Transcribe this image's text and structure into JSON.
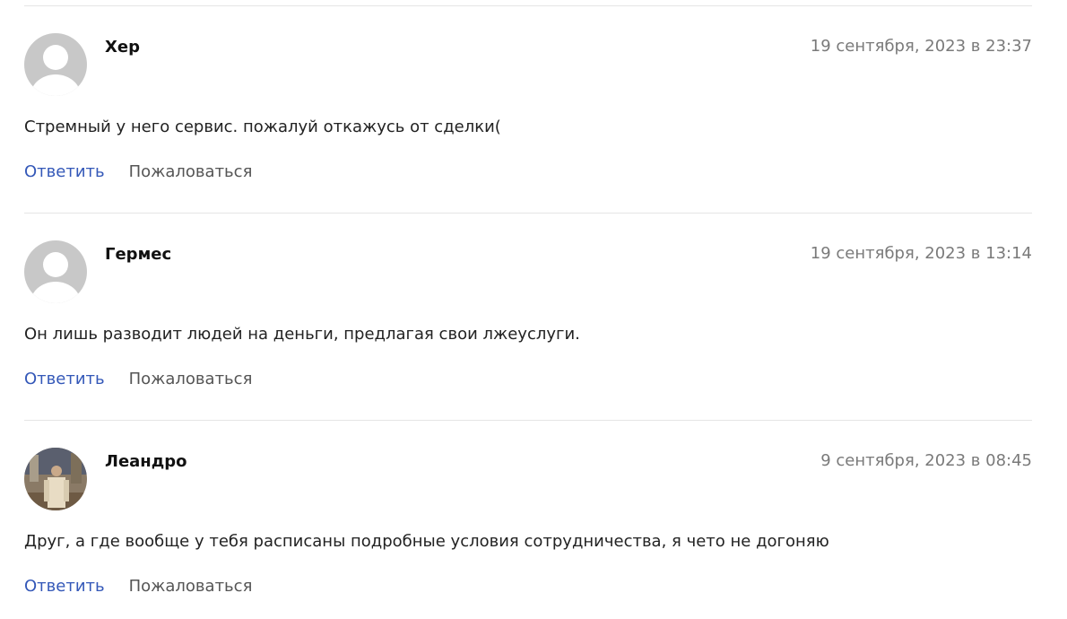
{
  "comments": [
    {
      "author": "Хер",
      "date": "19 сентября, 2023 в 23:37",
      "text": "Стремный у него сервис. пожалуй откажусь от сделки(",
      "avatar": "default-avatar-icon",
      "reply_label": "Ответить",
      "report_label": "Пожаловаться"
    },
    {
      "author": "Гермес",
      "date": "19 сентября, 2023 в 13:14",
      "text": "Он лишь разводит людей на деньги, предлагая свои лжеуслуги.",
      "avatar": "default-avatar-icon",
      "reply_label": "Ответить",
      "report_label": "Пожаловаться"
    },
    {
      "author": "Леандро",
      "date": "9 сентября, 2023 в 08:45",
      "text": "Друг, а где вообще у тебя расписаны подробные условия сотрудничества, я чето не догоняю",
      "avatar": "user-photo",
      "reply_label": "Ответить",
      "report_label": "Пожаловаться"
    }
  ],
  "colors": {
    "reply_link": "#3458b8",
    "report_link": "#555555",
    "date": "#7a7a7a",
    "divider": "#e5e5e5",
    "avatar_placeholder": "#c8c8c8"
  }
}
